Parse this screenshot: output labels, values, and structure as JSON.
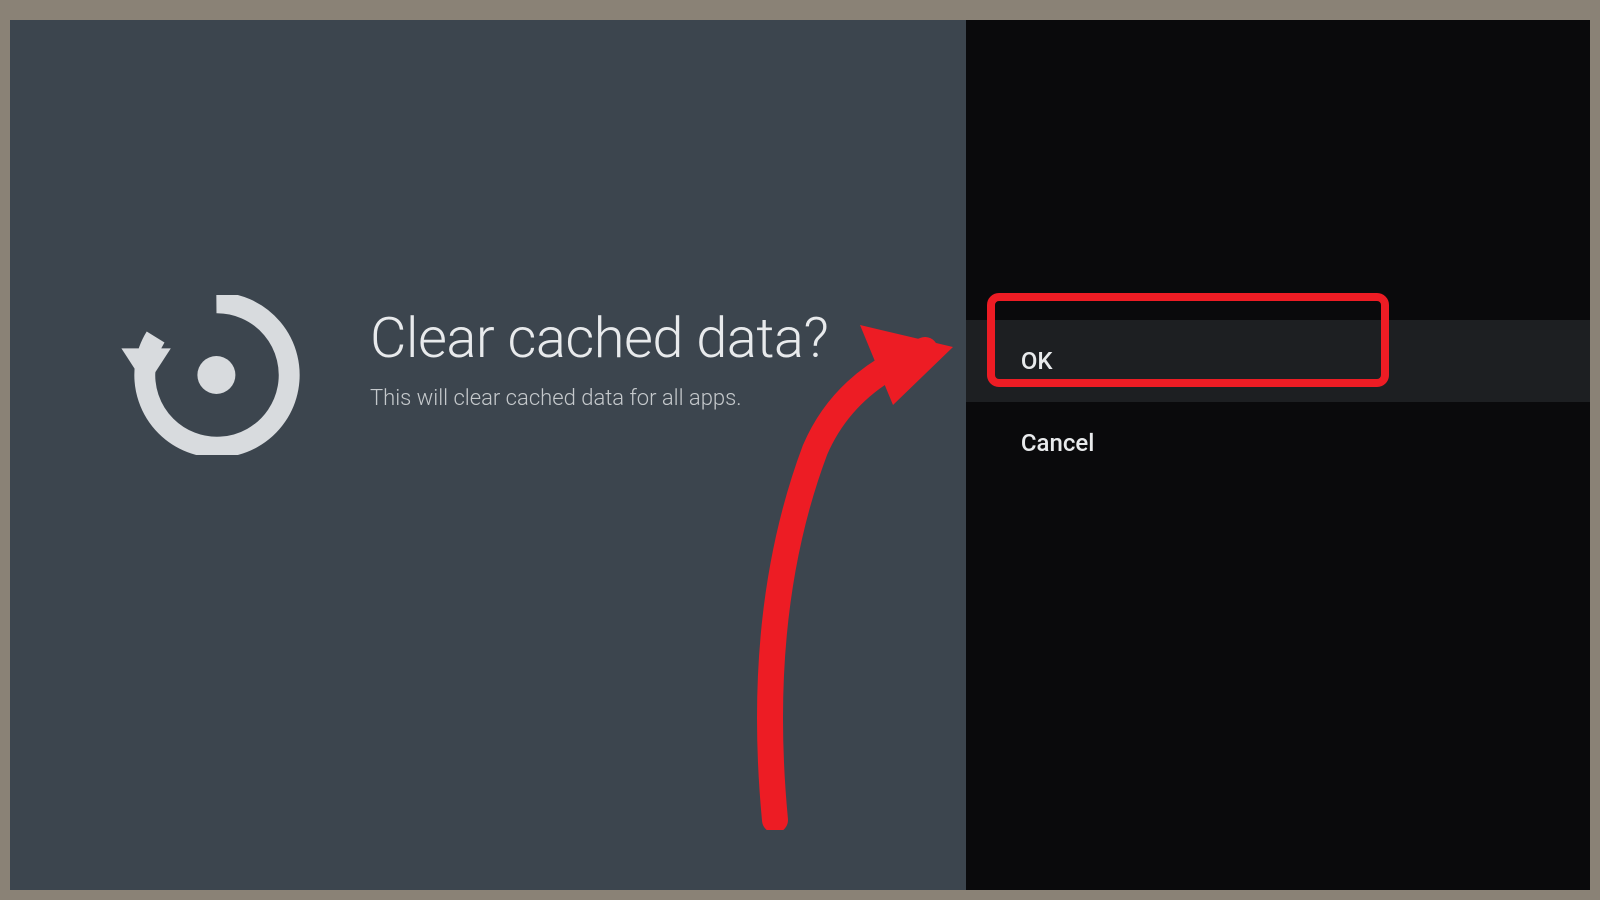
{
  "dialog": {
    "title": "Clear cached data?",
    "subtitle": "This will clear cached data for all apps.",
    "ok_label": "OK",
    "cancel_label": "Cancel"
  },
  "annotation": {
    "highlight_color": "#ed1c24"
  }
}
